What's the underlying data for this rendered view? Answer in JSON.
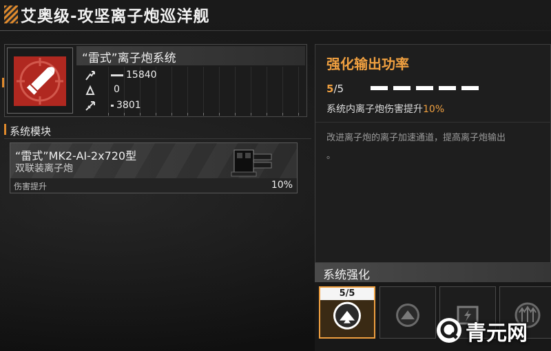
{
  "title": "艾奥级-攻坚离子炮巡洋舰",
  "system": {
    "name": "“雷式”离子炮系统",
    "icon": "bullet-icon",
    "stats": [
      {
        "icon": "firepower-icon",
        "value": "15840",
        "bar_fraction": 0.7
      },
      {
        "icon": "armor-icon",
        "value": "0",
        "bar_fraction": 0
      },
      {
        "icon": "speed-icon",
        "value": "3801",
        "bar_fraction": 0.2
      }
    ]
  },
  "modules": {
    "label": "系统模块",
    "items": [
      {
        "name": "“雷式”MK2-AI-2x720型",
        "type": "双联装离子炮",
        "stat_label": "伤害提升",
        "stat_value": "10%"
      }
    ]
  },
  "detail": {
    "title": "强化输出功率",
    "level_current": "5",
    "level_max": "/5",
    "pips_filled": 5,
    "effect_prefix": "系统内离子炮伤害提升",
    "effect_value": "10%",
    "description_line1": "改进离子炮的离子加速通道，提高离子炮输出",
    "description_line2": "。"
  },
  "enhancement": {
    "header": "系统强化",
    "slots": [
      {
        "level": "5/5",
        "icon": "power-up-icon",
        "active": true
      },
      {
        "icon": "power-up-icon",
        "active": false
      },
      {
        "icon": "battery-icon",
        "active": false
      },
      {
        "icon": "triple-arrow-icon",
        "active": false
      }
    ]
  },
  "watermark": {
    "text": "青元网",
    "icon": "q-logo-icon"
  },
  "colors": {
    "accent": "#f0a040",
    "icon_red": "#b02820",
    "background": "#141414"
  }
}
